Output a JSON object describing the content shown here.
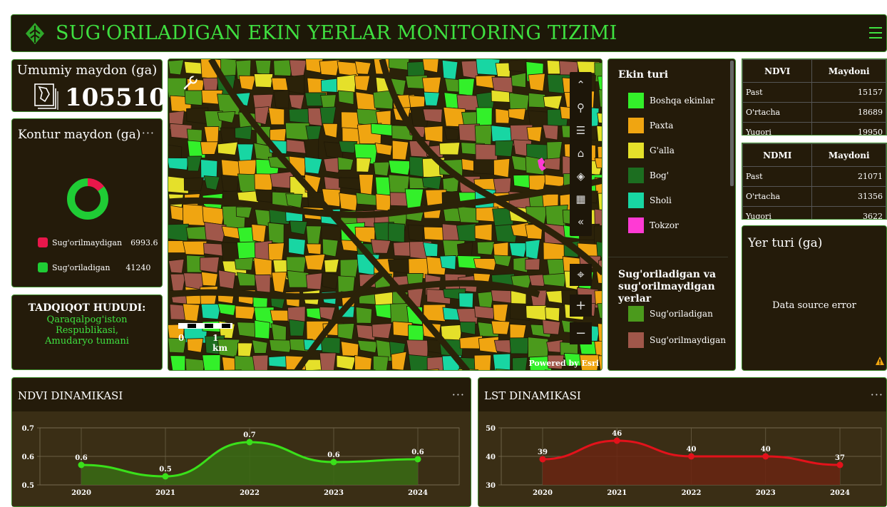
{
  "header": {
    "title": "SUG'ORILADIGAN EKIN YERLAR MONITORING TIZIMI",
    "logo_icon": "leaf-logo-icon",
    "menu_icon": "hamburger-menu-icon",
    "accent": "#3fe040"
  },
  "area": {
    "label": "Umumiy maydon (ga)",
    "value": "105510",
    "icon": "map-outline-icon"
  },
  "kontur": {
    "title": "Kontur maydon (ga)",
    "more": "···",
    "legend": [
      {
        "label": "Sug'orilmaydigan",
        "value": "6993.6",
        "color": "#e8174b"
      },
      {
        "label": "Sug'oriladigan",
        "value": "41240",
        "color": "#1fcc35"
      }
    ],
    "donut": [
      {
        "label": "Sug'orilmaydigan",
        "value": 6993.6,
        "color": "#e8174b"
      },
      {
        "label": "Sug'oriladigan",
        "value": 41240,
        "color": "#1fcc35"
      }
    ]
  },
  "tadqiqot": {
    "heading": "TADQIQOT HUDUDI:",
    "line1": "Qaraqalpog'iston Respublikasi,",
    "line2": "Amudaryo tumani"
  },
  "map": {
    "scale_zero": "0",
    "scale_label": "1 km",
    "attribution": "Powered by Esri",
    "tools": [
      "collapse-up-icon",
      "search-icon",
      "list-icon",
      "home-icon",
      "layers-icon",
      "basemap-gallery-icon",
      "collapse-left-icon"
    ],
    "buttons": {
      "locate": "⌖",
      "zoom_in": "+",
      "zoom_out": "−"
    }
  },
  "legend": {
    "heading1": "Ekin turi",
    "crops": [
      {
        "label": "Boshqa ekinlar",
        "color": "#33f02a"
      },
      {
        "label": "Paxta",
        "color": "#f0a511"
      },
      {
        "label": "G'alla",
        "color": "#e5e02a"
      },
      {
        "label": "Bog'",
        "color": "#1c6e20"
      },
      {
        "label": "Sholi",
        "color": "#18d6a3"
      },
      {
        "label": "Tokzor",
        "color": "#ff3ad4"
      }
    ],
    "heading2a": "Sug'oriladigan va",
    "heading2b": "sug'orilmaydigan yerlar",
    "irrigation": [
      {
        "label": "Sug'oriladigan",
        "color": "#4b9a1c"
      },
      {
        "label": "Sug'orilmaydigan",
        "color": "#a0574a"
      }
    ]
  },
  "ndvi_table": {
    "headers": [
      "NDVI",
      "Maydoni"
    ],
    "rows": [
      [
        "Past",
        "15157"
      ],
      [
        "O'rtacha",
        "18689"
      ],
      [
        "Yuqori",
        "19950"
      ]
    ]
  },
  "ndmi_table": {
    "headers": [
      "NDMI",
      "Maydoni"
    ],
    "rows": [
      [
        "Past",
        "21071"
      ],
      [
        "O'rtacha",
        "31356"
      ],
      [
        "Yuqori",
        "3622"
      ]
    ]
  },
  "yer": {
    "title": "Yer turi (ga)",
    "error": "Data source error",
    "warn_icon": "warning-icon"
  },
  "ndvi_panel": {
    "title": "NDVI DINAMIKASI",
    "more": "···"
  },
  "lst_panel": {
    "title": "LST DINAMIKASI",
    "more": "···"
  },
  "chart_data": [
    {
      "type": "area",
      "title": "NDVI DINAMIKASI",
      "categories": [
        "2020",
        "2021",
        "2022",
        "2023",
        "2024"
      ],
      "values": [
        0.57,
        0.53,
        0.65,
        0.58,
        0.59
      ],
      "labels": [
        "0.6",
        "0.5",
        "0.7",
        "0.6",
        "0.6"
      ],
      "yticks": [
        "0.7",
        "0.6",
        "0.5"
      ],
      "ylim": [
        0.5,
        0.7
      ],
      "color": "#3ae01a",
      "fill": "#3a6b14",
      "grid": true
    },
    {
      "type": "area",
      "title": "LST DINAMIKASI",
      "categories": [
        "2020",
        "2021",
        "2022",
        "2023",
        "2024"
      ],
      "values": [
        39,
        45.5,
        40,
        40,
        37
      ],
      "labels": [
        "39",
        "46",
        "40",
        "40",
        "37"
      ],
      "yticks": [
        "50",
        "40",
        "30"
      ],
      "ylim": [
        30,
        50
      ],
      "color": "#e3121b",
      "fill": "#6a2412",
      "grid": true
    }
  ]
}
